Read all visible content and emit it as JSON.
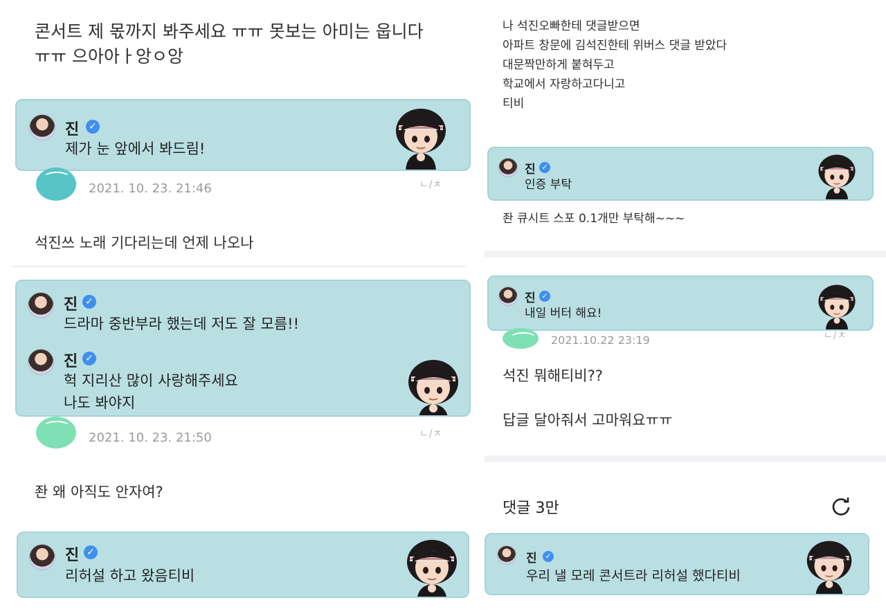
{
  "left": {
    "post1": "콘서트 제 몫까지 봐주세요 ㅠㅠ 못보는 아미는 웁니다\nㅠㅠ 으아아ㅏ앙ㅇ앙",
    "reply1": {
      "name": "진",
      "text": "제가 눈 앞에서 봐드림!"
    },
    "date1": "2021. 10. 23. 21:46",
    "post2": "석진쓰 노래 기다리는데 언제 나오나",
    "reply2a": {
      "name": "진",
      "text": "드라마 중반부라 했는데 저도 잘 모름!!"
    },
    "reply2b": {
      "name": "진",
      "text": "헉 지리산 많이 사랑해주세요\n나도 봐야지"
    },
    "date2": "2021. 10. 23. 21:50",
    "post3": "좐 왜 아직도 안자여?",
    "reply3": {
      "name": "진",
      "text": "리허설 하고 왔음티비"
    }
  },
  "right": {
    "post1": "나 석진오빠한테 댓글받으면\n아파트 창문에 김석진한테 위버스 댓글 받았다\n대문짝만하게 붙혀두고\n학교에서 자랑하고다니고\n티비",
    "reply1": {
      "name": "진",
      "text": "인증 부탁"
    },
    "post2": "좐 큐시트 스포 0.1개만 부탁해~~~",
    "reply2": {
      "name": "진",
      "text": "내일 버터 해요!"
    },
    "date2": "2021.10.22 23:19",
    "post3": "석진 뭐해티비??",
    "post4": "답글 달아줘서 고마워요ㅠㅠ",
    "comments_count": "댓글 3만",
    "reply3": {
      "name": "진",
      "text": "우리 낼 모레 콘서트라 리허설 했다티비"
    }
  },
  "translate_glyph": "ㄴ/ㅊ",
  "verified_glyph": "✓",
  "colors": {
    "card_bg": "#b9dfe3",
    "card_border": "#a5d2d7",
    "verified": "#3f8ff0",
    "date": "#9a9a9a"
  }
}
